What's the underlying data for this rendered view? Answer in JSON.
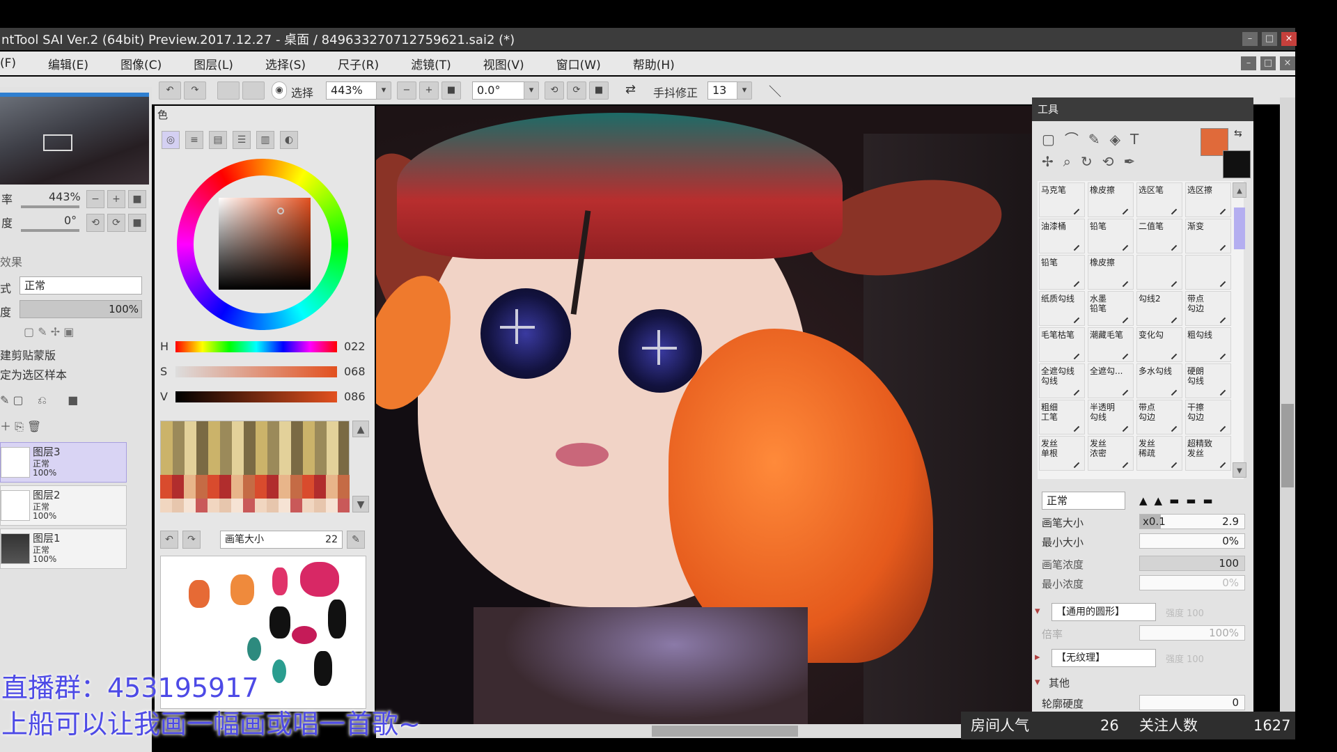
{
  "window": {
    "title": "ntTool SAI Ver.2 (64bit) Preview.2017.12.27 - 桌面 / 849633270712759621.sai2 (*)",
    "min_label": "–",
    "max_label": "□",
    "close_label": "×"
  },
  "menu": [
    "(F)",
    "编辑(E)",
    "图像(C)",
    "图层(L)",
    "选择(S)",
    "尺子(R)",
    "滤镜(T)",
    "视图(V)",
    "窗口(W)",
    "帮助(H)"
  ],
  "toolbar": {
    "select_label": "选择",
    "zoom": "443%",
    "angle": "0.0°",
    "stabilizer_label": "手抖修正",
    "stabilizer_value": "13"
  },
  "navigator": {
    "zoom_label": "率",
    "zoom_value": "443%",
    "angle_label": "度",
    "angle_value": "0°"
  },
  "layer_props": {
    "effect_label": "效果",
    "mode_label": "式",
    "mode_value": "正常",
    "opacity_label": "度",
    "opacity_value": "100%",
    "clip_label": "建剪贴蒙版",
    "sample_label": "定为选区样本"
  },
  "layers": [
    {
      "name": "图层3",
      "mode": "正常",
      "opacity": "100%",
      "selected": true
    },
    {
      "name": "图层2",
      "mode": "正常",
      "opacity": "100%",
      "selected": false
    },
    {
      "name": "图层1",
      "mode": "正常",
      "opacity": "100%",
      "selected": false
    }
  ],
  "color_panel": {
    "title": "色",
    "h_label": "H",
    "h_value": "022",
    "s_label": "S",
    "s_value": "068",
    "v_label": "V",
    "v_value": "086",
    "scratch_label": "画笔大小",
    "scratch_value": "22",
    "current_color": "#e06a3a",
    "secondary_color": "#111111"
  },
  "tool_panel": {
    "title": "工具",
    "tools": [
      "马克笔",
      "橡皮擦",
      "选区笔",
      "选区擦",
      "油漆桶",
      "铅笔",
      "二值笔",
      "渐变",
      "铅笔",
      "橡皮擦",
      "",
      "",
      "纸质勾线",
      "水墨\n铅笔",
      "勾线2",
      "带点\n勾边",
      "毛笔枯笔",
      "潮藏毛笔",
      "变化勾",
      "粗勾线",
      "全遮勾线\n勾线",
      "全遮勾...",
      "多水勾线",
      "硬朗\n勾线",
      "粗细\n工笔",
      "半透明\n勾线",
      "带点\n勾边",
      "干擦\n勾边",
      "发丝\n单根",
      "发丝\n浓密",
      "发丝\n稀疏",
      "超精致\n发丝"
    ],
    "blend_mode": "正常",
    "brush_size_label": "画笔大小",
    "brush_size_mult": "x0.1",
    "brush_size_value": "2.9",
    "min_size_label": "最小大小",
    "min_size_value": "0%",
    "density_label": "画笔浓度",
    "density_value": "100",
    "min_density_label": "最小浓度",
    "min_density_value": "0%",
    "shape_label": "【通用的圆形】",
    "shape_strength": "强度 100",
    "rate_label": "倍率",
    "rate_value": "100%",
    "texture_label": "【无纹理】",
    "texture_strength": "强度 100",
    "other_label": "其他",
    "edge_label": "轮廓硬度",
    "edge_value": "0"
  },
  "stream_overlay": {
    "line1": "直播群：453195917",
    "line2": "上船可以让我画一幅画或唱一首歌~",
    "popularity_label": "房间人气",
    "popularity_value": "26",
    "followers_label": "关注人数",
    "followers_value": "1627"
  }
}
